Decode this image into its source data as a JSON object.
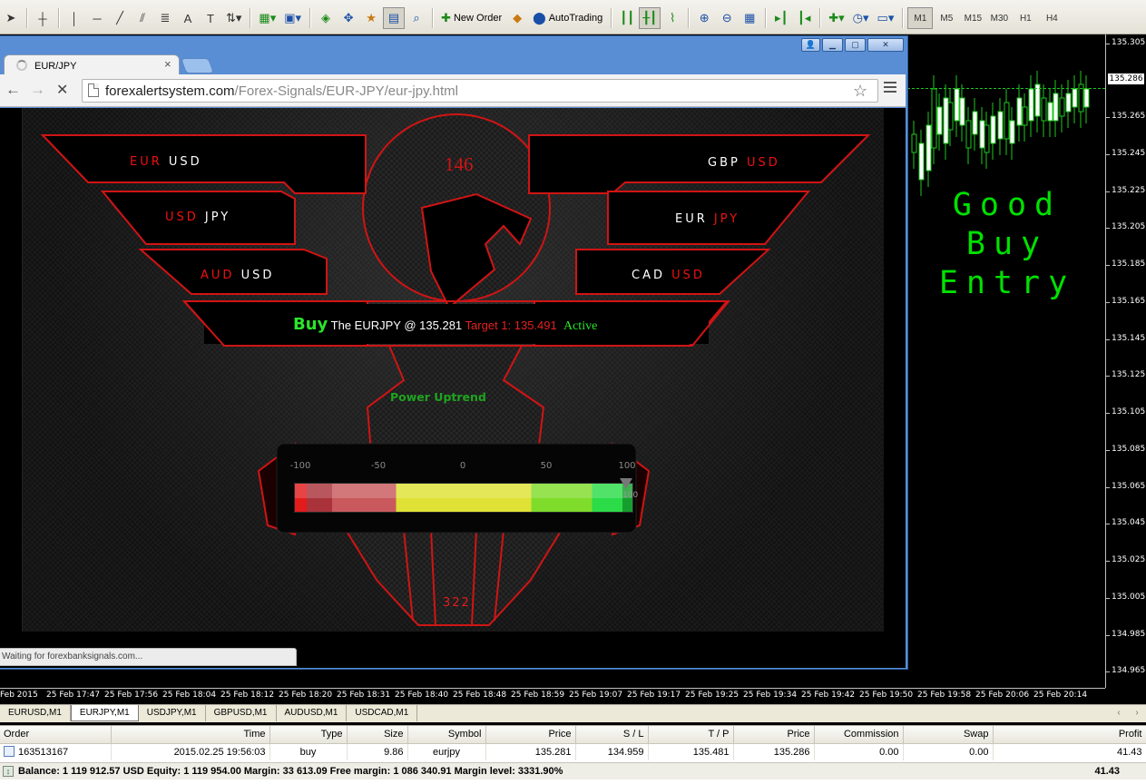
{
  "toolbar": {
    "new_order_label": "New Order",
    "autotrading_label": "AutoTrading",
    "timeframes": [
      "M1",
      "M5",
      "M15",
      "M30",
      "H1",
      "H4"
    ],
    "active_timeframe": "M1"
  },
  "browser": {
    "tab_title": "EUR/JPY",
    "url_host": "forexalertsystem.com",
    "url_path": "/Forex-Signals/EUR-JPY/eur-jpy.html",
    "status_text": "Waiting for forexbanksignals.com..."
  },
  "signal_page": {
    "score_top": "146",
    "score_bottom": "322",
    "pairs_left": [
      {
        "base": "EUR",
        "quote": "USD",
        "highlight": "base"
      },
      {
        "base": "USD",
        "quote": "JPY",
        "highlight": "base"
      },
      {
        "base": "AUD",
        "quote": "USD",
        "highlight": "base"
      }
    ],
    "pairs_right": [
      {
        "base": "GBP",
        "quote": "USD",
        "highlight": "quote"
      },
      {
        "base": "EUR",
        "quote": "JPY",
        "highlight": "quote"
      },
      {
        "base": "CAD",
        "quote": "USD",
        "highlight": "quote"
      }
    ],
    "signal_action": "Buy",
    "signal_text": "The EURJPY @ 135.281",
    "signal_target": "Target 1: 135.491",
    "signal_status": "Active",
    "trend_text": "Power Uptrend",
    "meter_ticks": [
      "-100",
      "-50",
      "0",
      "50",
      "100"
    ],
    "meter_value": "100",
    "colors": {
      "accent_red": "#ef1111",
      "signal_green": "#29e629"
    }
  },
  "chart": {
    "alert_lines": [
      "Good",
      "Buy",
      "Entry"
    ],
    "current_price": "135.286",
    "price_ticks": [
      "135.305",
      "135.265",
      "135.245",
      "135.225",
      "135.205",
      "135.185",
      "135.165",
      "135.145",
      "135.125",
      "135.105",
      "135.085",
      "135.065",
      "135.045",
      "135.025",
      "135.005",
      "134.985",
      "134.965"
    ],
    "time_ticks": [
      "Feb 2015",
      "25 Feb 17:47",
      "25 Feb 17:56",
      "25 Feb 18:04",
      "25 Feb 18:12",
      "25 Feb 18:20",
      "25 Feb 18:31",
      "25 Feb 18:40",
      "25 Feb 18:48",
      "25 Feb 18:59",
      "25 Feb 19:07",
      "25 Feb 19:17",
      "25 Feb 19:25",
      "25 Feb 19:34",
      "25 Feb 19:42",
      "25 Feb 19:50",
      "25 Feb 19:58",
      "25 Feb 20:06",
      "25 Feb 20:14"
    ],
    "bull_color": "#1ec71e"
  },
  "chart_tabs": [
    "EURUSD,M1",
    "EURJPY,M1",
    "USDJPY,M1",
    "GBPUSD,M1",
    "AUDUSD,M1",
    "USDCAD,M1"
  ],
  "active_chart_tab": "EURJPY,M1",
  "terminal": {
    "columns": [
      "Order",
      "Time",
      "Type",
      "Size",
      "Symbol",
      "Price",
      "S / L",
      "T / P",
      "Price",
      "Commission",
      "Swap",
      "Profit"
    ],
    "rows": [
      [
        "163513167",
        "2015.02.25 19:56:03",
        "buy",
        "9.86",
        "eurjpy",
        "135.281",
        "134.959",
        "135.481",
        "135.286",
        "0.00",
        "0.00",
        "41.43"
      ]
    ],
    "balance_line": "Balance: 1 119 912.57 USD  Equity: 1 119 954.00  Margin: 33 613.09  Free margin: 1 086 340.91  Margin level: 3331.90%",
    "total_profit": "41.43"
  }
}
